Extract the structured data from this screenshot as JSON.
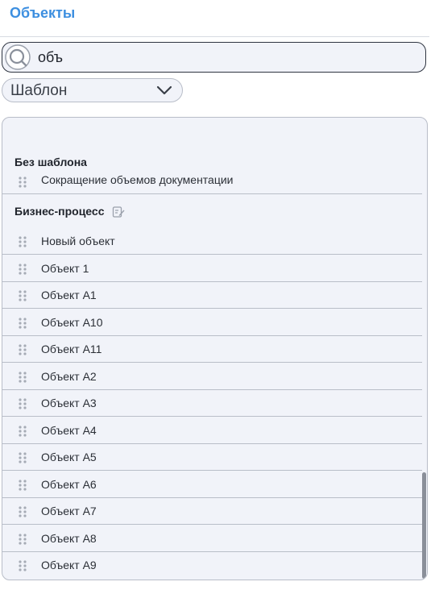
{
  "header": {
    "title": "Объекты"
  },
  "search": {
    "value": "объ",
    "placeholder": ""
  },
  "template_filter": {
    "selected": "Шаблон"
  },
  "groups": [
    {
      "header": "Без шаблона",
      "items": [
        "Сокращение объемов документации"
      ]
    },
    {
      "header": "Бизнес-процесс",
      "items": [
        "Новый объект",
        "Объект 1",
        "Объект А1",
        "Объект А10",
        "Объект А11",
        "Объект А2",
        "Объект А3",
        "Объект А4",
        "Объект А5",
        "Объект А6",
        "Объект А7",
        "Объект А8",
        "Объект А9"
      ]
    }
  ],
  "icons": {
    "search": "search-icon",
    "chevron": "chevron-down-icon",
    "edit": "edit-icon",
    "drag": "drag-handle-icon"
  },
  "colors": {
    "title": "#3d8fe0",
    "panel_bg": "#f1f3f9",
    "divider": "#b9bec8"
  }
}
